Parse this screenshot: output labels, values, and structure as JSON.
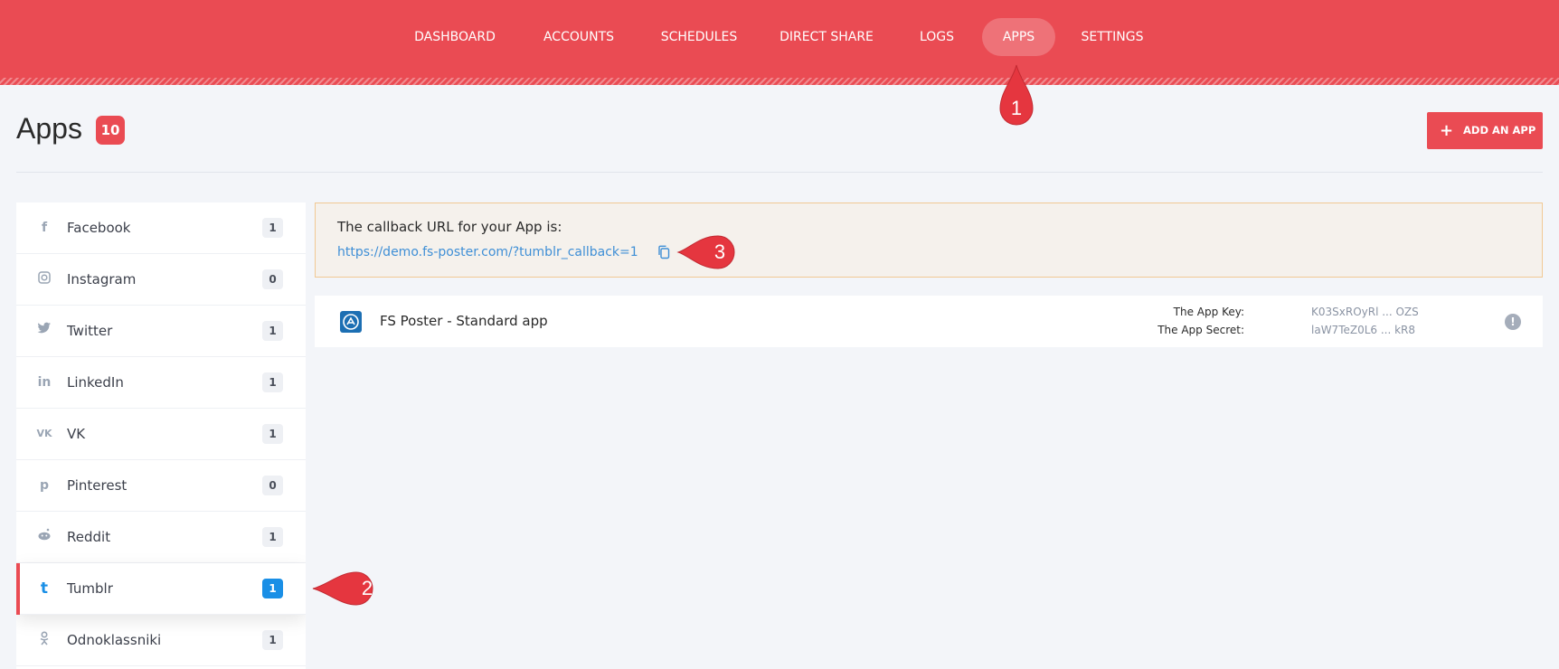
{
  "nav": {
    "items": [
      {
        "label": "DASHBOARD"
      },
      {
        "label": "ACCOUNTS"
      },
      {
        "label": "SCHEDULES"
      },
      {
        "label": "DIRECT SHARE"
      },
      {
        "label": "LOGS"
      },
      {
        "label": "APPS",
        "active": true
      },
      {
        "label": "SETTINGS"
      }
    ]
  },
  "header": {
    "title": "Apps",
    "count": "10",
    "add_button": "ADD AN APP"
  },
  "sidebar": {
    "items": [
      {
        "label": "Facebook",
        "count": "1",
        "icon": "facebook-icon"
      },
      {
        "label": "Instagram",
        "count": "0",
        "icon": "instagram-icon"
      },
      {
        "label": "Twitter",
        "count": "1",
        "icon": "twitter-icon"
      },
      {
        "label": "LinkedIn",
        "count": "1",
        "icon": "linkedin-icon"
      },
      {
        "label": "VK",
        "count": "1",
        "icon": "vk-icon"
      },
      {
        "label": "Pinterest",
        "count": "0",
        "icon": "pinterest-icon"
      },
      {
        "label": "Reddit",
        "count": "1",
        "icon": "reddit-icon"
      },
      {
        "label": "Tumblr",
        "count": "1",
        "icon": "tumblr-icon",
        "active": true
      },
      {
        "label": "Odnoklassniki",
        "count": "1",
        "icon": "odnoklassniki-icon"
      }
    ]
  },
  "callback": {
    "title": "The callback URL for your App is:",
    "url": "https://demo.fs-poster.com/?tumblr_callback=1"
  },
  "app": {
    "name": "FS Poster - Standard app",
    "key_label": "The App Key:",
    "key_value": "K03SxROyRl ... OZS",
    "secret_label": "The App Secret:",
    "secret_value": "laW7TeZ0L6 ... kR8"
  },
  "markers": [
    "1",
    "2",
    "3"
  ],
  "colors": {
    "brand": "#ea4b53",
    "active_badge": "#1a8fe6",
    "link": "#3f8fd6",
    "callback_bg": "#f5f1ec",
    "callback_border": "#f1c994"
  }
}
